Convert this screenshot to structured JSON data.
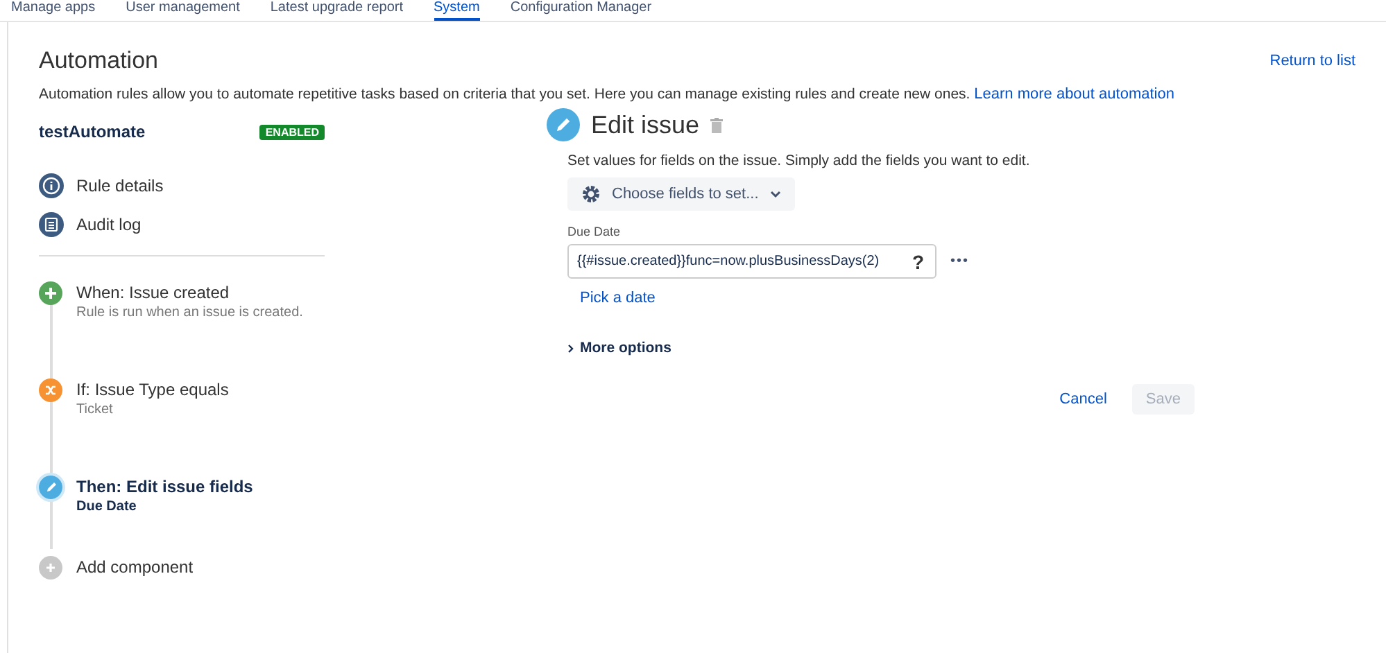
{
  "tabs": [
    {
      "label": "Manage apps",
      "selected": false
    },
    {
      "label": "User management",
      "selected": false
    },
    {
      "label": "Latest upgrade report",
      "selected": false
    },
    {
      "label": "System",
      "selected": true
    },
    {
      "label": "Configuration Manager",
      "selected": false
    }
  ],
  "header": {
    "title": "Automation",
    "return_link": "Return to list",
    "description": "Automation rules allow you to automate repetitive tasks based on criteria that you set. Here you can manage existing rules and create new ones.",
    "learn_link": "Learn more about automation"
  },
  "rule": {
    "name": "testAutomate",
    "status": "ENABLED",
    "enabled": true
  },
  "menu": [
    {
      "kind": "info",
      "label": "Rule details"
    },
    {
      "kind": "log",
      "label": "Audit log"
    }
  ],
  "components": [
    {
      "kind": "trigger",
      "title": "When: Issue created",
      "subtitle": "Rule is run when an issue is created.",
      "selected": false
    },
    {
      "kind": "condition",
      "title": "If: Issue Type equals",
      "subtitle": "Ticket",
      "selected": false
    },
    {
      "kind": "action",
      "title": "Then: Edit issue fields",
      "subtitle": "Due Date",
      "selected": true
    },
    {
      "kind": "add",
      "title": "Add component",
      "selected": false
    }
  ],
  "editor": {
    "title": "Edit issue",
    "description": "Set values for fields on the issue. Simply add the fields you want to edit.",
    "choose_button": "Choose fields to set...",
    "field_label": "Due Date",
    "field_value": "{{#issue.created}}func=now.plusBusinessDays(2)",
    "help": "?",
    "more": "•••",
    "pick_link": "Pick a date",
    "more_options": "More options",
    "cancel": "Cancel",
    "save": "Save",
    "save_disabled": true
  }
}
